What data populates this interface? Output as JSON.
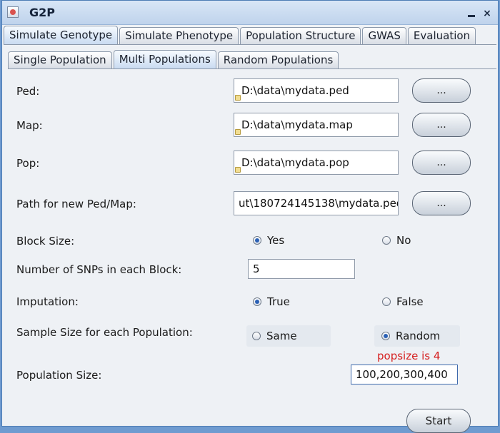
{
  "window": {
    "title": "G2P",
    "close_glyph": "×"
  },
  "tabs_main": [
    {
      "label": "Simulate Genotype",
      "active": true
    },
    {
      "label": "Simulate Phenotype",
      "active": false
    },
    {
      "label": "Population Structure",
      "active": false
    },
    {
      "label": "GWAS",
      "active": false
    },
    {
      "label": "Evaluation",
      "active": false
    }
  ],
  "tabs_sub": [
    {
      "label": "Single Population",
      "active": false
    },
    {
      "label": "Multi Populations",
      "active": true
    },
    {
      "label": "Random Populations",
      "active": false
    }
  ],
  "files": {
    "ped": {
      "label": "Ped:",
      "value": "D:\\data\\mydata.ped",
      "button": "..."
    },
    "map": {
      "label": "Map:",
      "value": "D:\\data\\mydata.map",
      "button": "..."
    },
    "pop": {
      "label": "Pop:",
      "value": "D:\\data\\mydata.pop",
      "button": "..."
    },
    "newpath": {
      "label": "Path for new Ped/Map:",
      "value": "ut\\180724145138\\mydata.ped",
      "button": "..."
    }
  },
  "options": {
    "block_size": {
      "label": "Block Size:",
      "option_a": "Yes",
      "option_b": "No",
      "selected": "Yes"
    },
    "snps_per_block": {
      "label": "Number of SNPs in each Block:",
      "value": "5"
    },
    "imputation": {
      "label": "Imputation:",
      "option_a": "True",
      "option_b": "False",
      "selected": "True"
    },
    "sample_size": {
      "label": "Sample Size for each Population:",
      "option_a": "Same",
      "option_b": "Random",
      "selected": "Random"
    },
    "popsize_note": "popsize is 4",
    "population_size": {
      "label": "Population Size:",
      "value": "100,200,300,400"
    }
  },
  "actions": {
    "start": "Start"
  },
  "colors": {
    "note_red": "#d61f1f",
    "radio_selected": "#2b61b5",
    "window_border": "#4d7db5"
  }
}
